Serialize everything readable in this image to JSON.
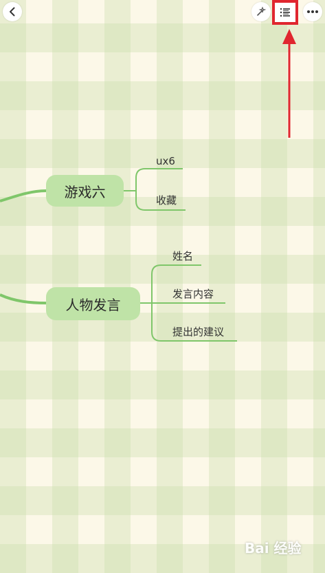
{
  "toolbar": {
    "back_icon": "chevron-left-icon",
    "wand_icon": "magic-wand-icon",
    "outline_icon": "list-icon",
    "more_icon": "more-horizontal-icon"
  },
  "colors": {
    "branch": "#7fc66a",
    "node_fill": "#bfe3a7",
    "highlight": "#e0262f"
  },
  "mindmap": {
    "topic1": {
      "label": "游戏六",
      "children": [
        "ux6",
        "收藏"
      ]
    },
    "topic2": {
      "label": "人物发言",
      "children": [
        "姓名",
        "发言内容",
        "提出的建议"
      ]
    }
  },
  "watermark": {
    "text": "Bai 经验"
  }
}
